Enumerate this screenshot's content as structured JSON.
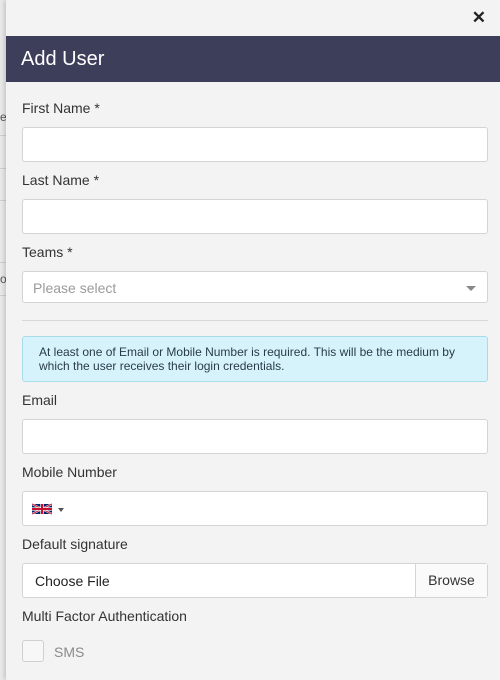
{
  "dialog": {
    "close_symbol": "✕",
    "title": "Add User"
  },
  "form": {
    "first_name": {
      "label": "First Name *",
      "value": ""
    },
    "last_name": {
      "label": "Last Name *",
      "value": ""
    },
    "teams": {
      "label": "Teams *",
      "placeholder": "Please select"
    },
    "info_message": "At least one of Email or Mobile Number is required. This will be the medium by which the user receives their login credentials.",
    "email": {
      "label": "Email",
      "value": ""
    },
    "mobile": {
      "label": "Mobile Number",
      "country_flag": "uk-flag-icon",
      "value": ""
    },
    "signature": {
      "label": "Default signature",
      "choose_label": "Choose File",
      "browse_label": "Browse"
    },
    "mfa": {
      "label": "Multi Factor Authentication",
      "sms_label": "SMS",
      "sms_checked": false
    }
  },
  "background": {
    "fragments": [
      "er",
      "ou"
    ]
  },
  "colors": {
    "header_bg": "#3d3e5a",
    "info_bg": "#d6f3fb",
    "panel_bg": "#f3f3f3"
  }
}
